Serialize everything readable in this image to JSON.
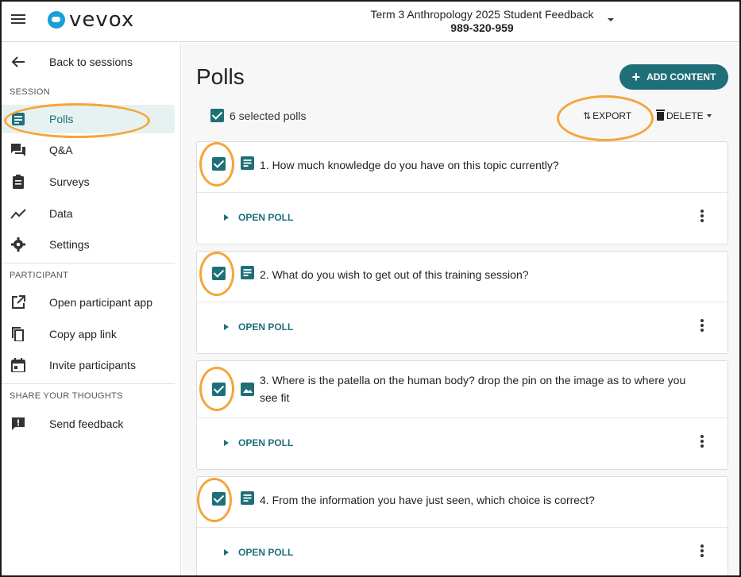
{
  "header": {
    "logo_text": "vevox",
    "session_name": "Term 3 Anthropology 2025 Student Feedback",
    "session_code": "989-320-959"
  },
  "sidebar": {
    "back_label": "Back to sessions",
    "session_section": "SESSION",
    "session_items": [
      {
        "label": "Polls",
        "icon": "polls-icon"
      },
      {
        "label": "Q&A",
        "icon": "qa-icon"
      },
      {
        "label": "Surveys",
        "icon": "clipboard-icon"
      },
      {
        "label": "Data",
        "icon": "chart-line-icon"
      },
      {
        "label": "Settings",
        "icon": "gear-icon"
      }
    ],
    "participant_section": "PARTICIPANT",
    "participant_items": [
      {
        "label": "Open participant app",
        "icon": "external-link-icon"
      },
      {
        "label": "Copy app link",
        "icon": "copy-icon"
      },
      {
        "label": "Invite participants",
        "icon": "calendar-icon"
      }
    ],
    "feedback_section": "SHARE YOUR THOUGHTS",
    "feedback_items": [
      {
        "label": "Send feedback",
        "icon": "feedback-icon"
      }
    ]
  },
  "main": {
    "title": "Polls",
    "add_content_label": "ADD CONTENT",
    "selected_label": "6 selected polls",
    "export_label": "EXPORT",
    "delete_label": "DELETE",
    "open_poll_label": "OPEN POLL",
    "polls": [
      {
        "text": "1. How much knowledge do you have on this topic currently?",
        "type_icon": "list-poll-icon",
        "checked": true
      },
      {
        "text": "2. What do you wish to get out of this training session?",
        "type_icon": "list-poll-icon",
        "checked": true
      },
      {
        "text": "3. Where is the patella on the human body? drop the pin on the image as to where you see fit",
        "type_icon": "image-poll-icon",
        "checked": true
      },
      {
        "text": "4. From the information you have just seen, which choice is correct?",
        "type_icon": "list-poll-icon",
        "checked": true
      }
    ]
  },
  "colors": {
    "accent": "#1f6f78",
    "highlight": "#f5a53a",
    "active_bg": "#e6f1f1",
    "logo_blue": "#18a0d6"
  }
}
